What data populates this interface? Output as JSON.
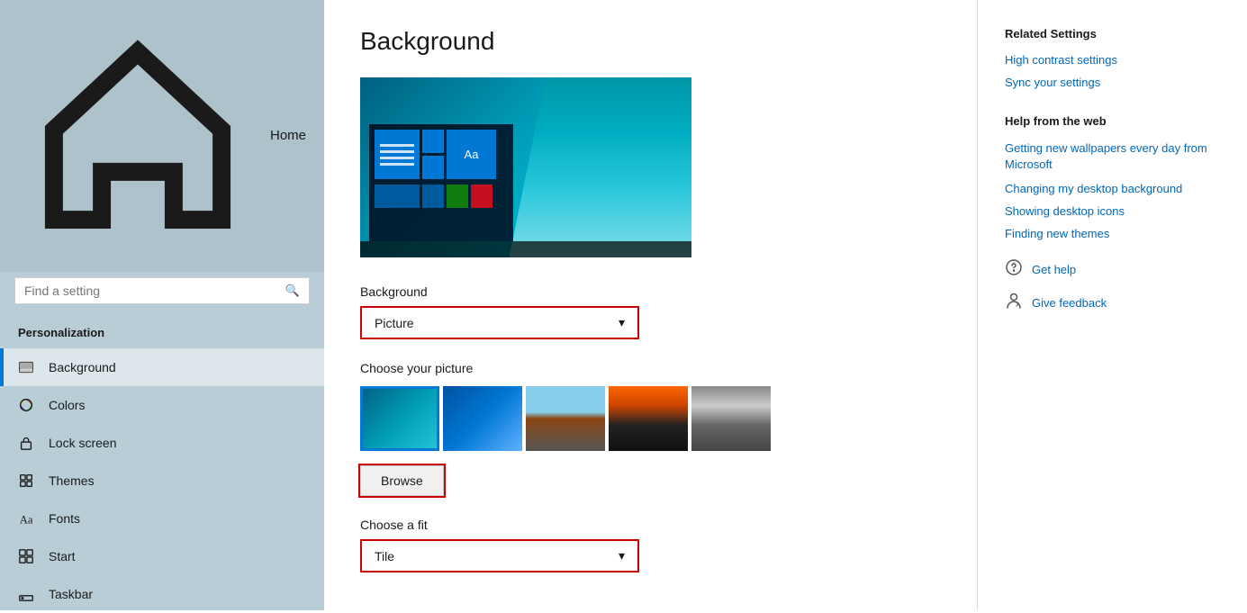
{
  "sidebar": {
    "home_label": "Home",
    "search_placeholder": "Find a setting",
    "section_title": "Personalization",
    "items": [
      {
        "id": "background",
        "label": "Background",
        "active": true
      },
      {
        "id": "colors",
        "label": "Colors",
        "active": false
      },
      {
        "id": "lock-screen",
        "label": "Lock screen",
        "active": false
      },
      {
        "id": "themes",
        "label": "Themes",
        "active": false
      },
      {
        "id": "fonts",
        "label": "Fonts",
        "active": false
      },
      {
        "id": "start",
        "label": "Start",
        "active": false
      },
      {
        "id": "taskbar",
        "label": "Taskbar",
        "active": false
      }
    ]
  },
  "main": {
    "page_title": "Background",
    "background_label": "Background",
    "background_value": "Picture",
    "choose_picture_label": "Choose your picture",
    "browse_label": "Browse",
    "choose_fit_label": "Choose a fit",
    "fit_value": "Tile",
    "dropdown_arrow": "▾"
  },
  "right_panel": {
    "related_settings_title": "Related Settings",
    "related_links": [
      {
        "id": "high-contrast",
        "label": "High contrast settings"
      },
      {
        "id": "sync-settings",
        "label": "Sync your settings"
      }
    ],
    "help_title": "Help from the web",
    "help_links": [
      {
        "id": "new-wallpapers",
        "label": "Getting new wallpapers every day from Microsoft"
      },
      {
        "id": "change-bg",
        "label": "Changing my desktop background"
      },
      {
        "id": "desktop-icons",
        "label": "Showing desktop icons"
      },
      {
        "id": "new-themes",
        "label": "Finding new themes"
      }
    ],
    "get_help_label": "Get help",
    "give_feedback_label": "Give feedback"
  }
}
